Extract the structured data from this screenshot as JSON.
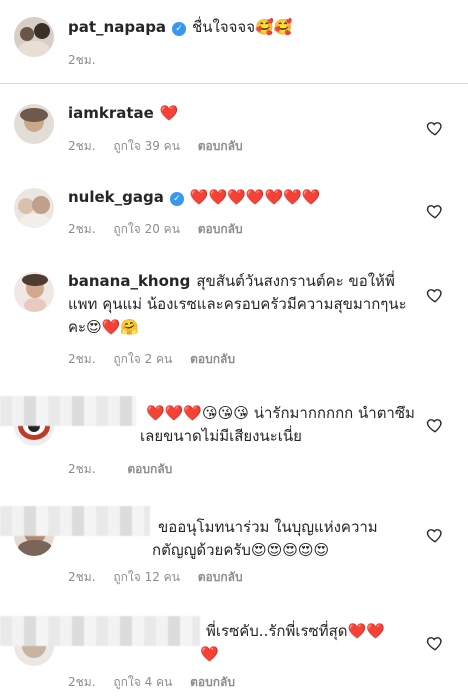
{
  "post": {
    "username": "pat_napapa",
    "caption": "ชื่นใจจจจ🥰🥰",
    "time": "2ชม."
  },
  "comments": [
    {
      "username": "iamkratae",
      "text": "❤️",
      "time": "2ชม.",
      "likes": "ถูกใจ 39 คน",
      "reply": "ตอบกลับ"
    },
    {
      "username": "nulek_gaga",
      "text": "❤️❤️❤️❤️❤️❤️❤️",
      "time": "2ชม.",
      "likes": "ถูกใจ 20 คน",
      "reply": "ตอบกลับ"
    },
    {
      "username": "banana_khong",
      "text": "สุขสันต์วันสงกรานต์คะ ขอให้พี่แพท คุนแม่ น้องเรซและครอบครัวมีความสุขมากๆนะคะ😍❤️🤗",
      "time": "2ชม.",
      "likes": "ถูกใจ 2 คน",
      "reply": "ตอบกลับ"
    },
    {
      "username": "",
      "text": "❤️❤️❤️😘😘😘 น่ารักมากกกกก นำตาซึมเลยขนาดไม่มีเสียงนะเนี่ย",
      "time": "2ชม.",
      "likes": "",
      "reply": "ตอบกลับ"
    },
    {
      "username": "",
      "text": "ขออนุโมทนาร่วม ในบุญแห่งความกตัญญูด้วยครับ😍😍😍😍😍",
      "time": "2ชม.",
      "likes": "ถูกใจ 12 คน",
      "reply": "ตอบกลับ"
    },
    {
      "username": "",
      "text": "พี่เรซคับ..รักพี่เรซที่สุด❤️❤️❤️",
      "time": "2ชม.",
      "likes": "ถูกใจ 4 คน",
      "reply": "ตอบกลับ"
    }
  ]
}
